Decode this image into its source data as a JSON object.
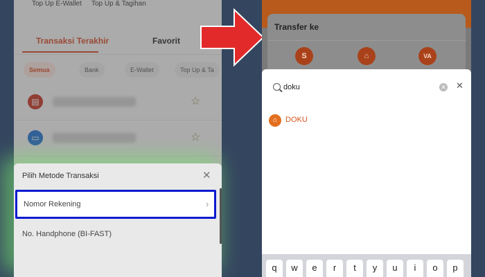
{
  "left": {
    "top_items": [
      "Top Up E-Wallet",
      "Top Up & Tagihan"
    ],
    "tabs": [
      "Transaksi Terakhir",
      "Favorit"
    ],
    "chips": [
      "Semua",
      "Bank",
      "E-Wallet",
      "Top Up & Ta"
    ],
    "sheet": {
      "title": "Pilih Metode Transaksi",
      "option1": "Nomor Rekening",
      "option2": "No. Handphone (BI-FAST)"
    }
  },
  "right": {
    "card_title": "Transfer ke",
    "card_icons": [
      "S",
      "bank",
      "VA"
    ],
    "search": {
      "value": "doku"
    },
    "result": "DOKU",
    "keys": [
      "q",
      "w",
      "e",
      "r",
      "t",
      "y",
      "u",
      "i",
      "o",
      "p"
    ]
  },
  "colors": {
    "accent": "#d6451f",
    "highlight_border": "#0b1bd0",
    "glow": "#7be66e",
    "arrow": "#e32a2a",
    "background": "#34465f"
  },
  "icons": {
    "tx1": "wallet-icon",
    "tx2": "card-icon",
    "star": "star-icon",
    "close": "close-icon",
    "chevron": "chevron-right-icon",
    "search": "search-icon",
    "clear": "clear-icon",
    "bank": "bank-icon"
  }
}
